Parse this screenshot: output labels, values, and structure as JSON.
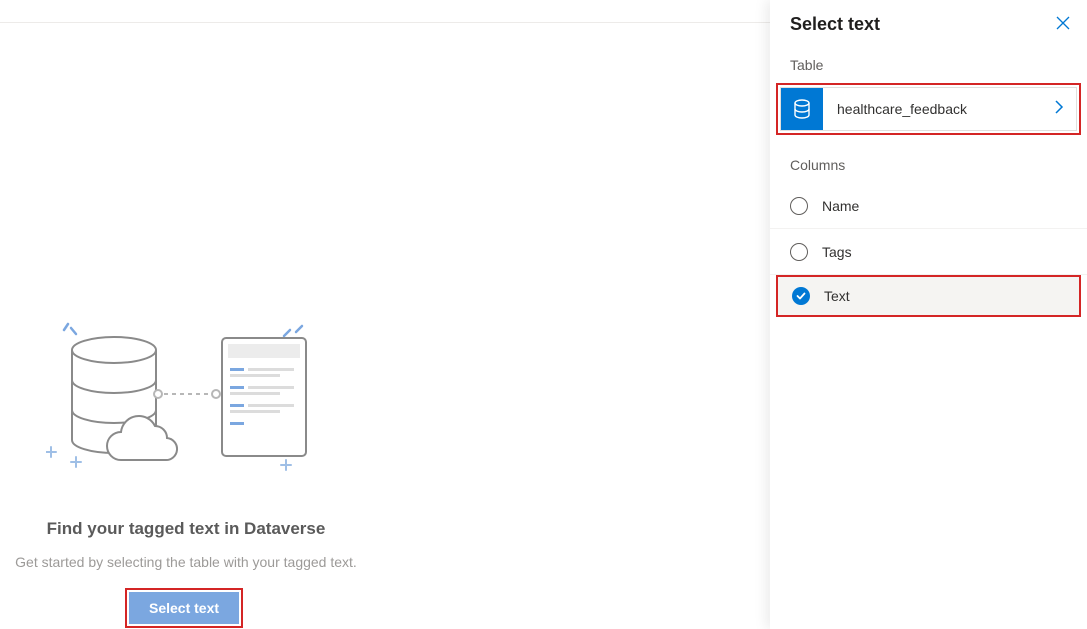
{
  "main": {
    "heading": "Find your tagged text in Dataverse",
    "subtext": "Get started by selecting the table with your tagged text.",
    "button_label": "Select text"
  },
  "panel": {
    "title": "Select text",
    "section_table_label": "Table",
    "table_name": "healthcare_feedback",
    "section_columns_label": "Columns",
    "columns": [
      {
        "label": "Name",
        "selected": false
      },
      {
        "label": "Tags",
        "selected": false
      },
      {
        "label": "Text",
        "selected": true
      }
    ]
  },
  "colors": {
    "accent": "#0078d4",
    "highlight_border": "#d42525"
  }
}
